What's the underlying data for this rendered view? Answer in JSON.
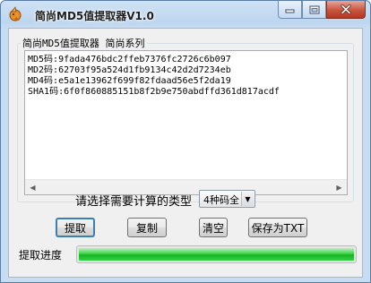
{
  "window": {
    "title": "简尚MD5值提取器V1.0",
    "minimize_icon": "minimize-icon",
    "maximize_icon": "maximize-icon",
    "close_icon": "close-icon"
  },
  "group": {
    "label": "简尚MD5值提取器  简尚系列"
  },
  "output": {
    "lines": [
      "MD5码:9fada476bdc2ffeb7376fc2726c6b097",
      "MD2码:62703f95a524d1fb9134c42d2d7234eb",
      "MD4码:e5a1e13962f699f82fdaad56e5f2da19",
      "SHA1码:6f0f860885151b8f2b9e750abdffd361d817acdf"
    ]
  },
  "type_select": {
    "label": "请选择需要计算的类型",
    "value": "4种码全",
    "arrow_icon": "chevron-down-icon"
  },
  "buttons": {
    "extract": "提取",
    "copy": "复制",
    "clear": "清空",
    "save": "保存为TXT"
  },
  "progress": {
    "label": "提取进度",
    "value": 1.0
  },
  "colors": {
    "title_bar": "#bdd6ee",
    "close_button": "#c8553e",
    "progress_fill": "#17b626",
    "default_button_border": "#3c7fb1"
  }
}
